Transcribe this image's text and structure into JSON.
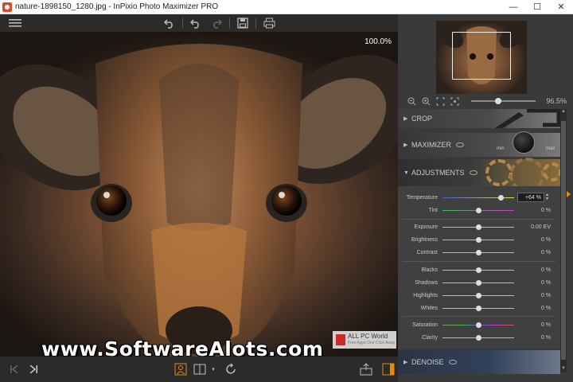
{
  "window": {
    "title": "nature-1898150_1280.jpg - InPixio Photo Maximizer PRO",
    "controls": [
      "—",
      "☐",
      "✕"
    ]
  },
  "toolbar": {
    "menu_icon": "menu-icon",
    "undo_icon": "undo-icon",
    "redo_icon": "redo-icon",
    "save_icon": "save-icon",
    "print_icon": "print-icon"
  },
  "canvas": {
    "zoom": "100.0%"
  },
  "watermark": {
    "text": "www.SoftwareAlots.com",
    "badge_title": "ALL PC World",
    "badge_sub": "Free Apps One Click Away"
  },
  "navigator": {
    "zoom_value": "96.5%",
    "zoom_level": 0.42
  },
  "sections": {
    "crop": "CROP",
    "maximizer": "MAXIMIZER",
    "maximizer_min": "min",
    "maximizer_max": "max",
    "adjustments": "ADJUSTMENTS",
    "denoise": "DENOISE"
  },
  "adjustments": [
    {
      "label": "Temperature",
      "value": "+64 %",
      "level": 0.82,
      "boxed": true
    },
    {
      "label": "Tint",
      "value": "0 %",
      "level": 0.5
    },
    {
      "label": "Exposure",
      "value": "0.00 EV",
      "level": 0.5
    },
    {
      "label": "Brightness",
      "value": "0 %",
      "level": 0.5
    },
    {
      "label": "Contrast",
      "value": "0 %",
      "level": 0.5
    },
    {
      "label": "Blacks",
      "value": "0 %",
      "level": 0.5
    },
    {
      "label": "Shadows",
      "value": "0 %",
      "level": 0.5
    },
    {
      "label": "Highlights",
      "value": "0 %",
      "level": 0.5
    },
    {
      "label": "Whites",
      "value": "0 %",
      "level": 0.5
    },
    {
      "label": "Saturation",
      "value": "0 %",
      "level": 0.5
    },
    {
      "label": "Clarity",
      "value": "0 %",
      "level": 0.5
    }
  ],
  "colors": {
    "accent": "#e08a1a",
    "panel": "#3a3a3a",
    "toolbar": "#2b2b2b"
  }
}
